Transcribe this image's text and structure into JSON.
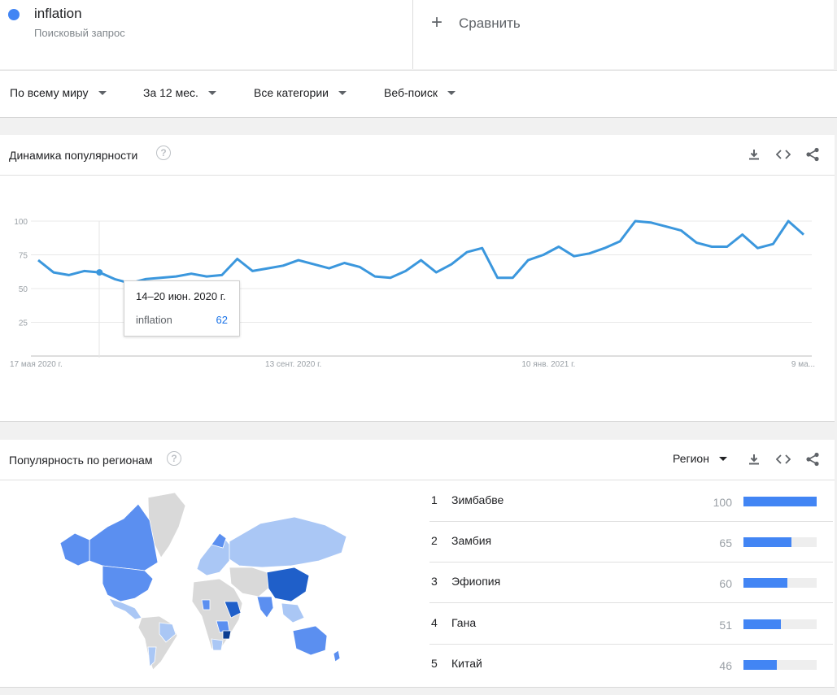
{
  "search_term": {
    "name": "inflation",
    "type": "Поисковый запрос",
    "color": "#4285f4"
  },
  "compare": {
    "label": "Сравнить",
    "icon": "plus-icon"
  },
  "filters": [
    {
      "label": "По всему миру"
    },
    {
      "label": "За 12 мес."
    },
    {
      "label": "Все категории"
    },
    {
      "label": "Веб-поиск"
    }
  ],
  "interest_over_time": {
    "title": "Динамика популярности",
    "tools": [
      "download-icon",
      "embed-code-icon",
      "share-icon"
    ],
    "tooltip": {
      "date": "14–20 июн. 2020 г.",
      "term": "inflation",
      "value": "62"
    }
  },
  "chart_data": {
    "type": "line",
    "x_tick_labels": [
      "17 мая 2020 г.",
      "13 сент. 2020 г.",
      "10 янв. 2021 г.",
      "9 ма..."
    ],
    "y_tick_labels": [
      "100",
      "75",
      "50",
      "25"
    ],
    "ylim": [
      0,
      100
    ],
    "series": [
      {
        "color": "#3b97dd",
        "values": [
          71,
          62,
          60,
          63,
          62,
          57,
          54,
          57,
          58,
          59,
          61,
          59,
          60,
          72,
          63,
          65,
          67,
          71,
          68,
          65,
          69,
          66,
          59,
          58,
          63,
          71,
          62,
          68,
          77,
          80,
          58,
          58,
          71,
          75,
          81,
          74,
          76,
          80,
          85,
          100,
          99,
          96,
          93,
          84,
          81,
          81,
          90,
          80,
          83,
          100,
          90
        ]
      }
    ]
  },
  "interest_by_region": {
    "title": "Популярность по регионам",
    "selector": "Регион",
    "tools": [
      "download-icon",
      "embed-code-icon",
      "share-icon"
    ],
    "rows": [
      {
        "rank": "1",
        "name": "Зимбабве",
        "value": "100",
        "fraction": 1.0
      },
      {
        "rank": "2",
        "name": "Замбия",
        "value": "65",
        "fraction": 0.65
      },
      {
        "rank": "3",
        "name": "Эфиопия",
        "value": "60",
        "fraction": 0.6
      },
      {
        "rank": "4",
        "name": "Гана",
        "value": "51",
        "fraction": 0.51
      },
      {
        "rank": "5",
        "name": "Китай",
        "value": "46",
        "fraction": 0.46
      }
    ],
    "map_colors": {
      "high": "#1f5fc9",
      "mid": "#5b8ff0",
      "low": "#aac7f5",
      "none": "#d9d9d9"
    }
  },
  "help_icon": "?"
}
